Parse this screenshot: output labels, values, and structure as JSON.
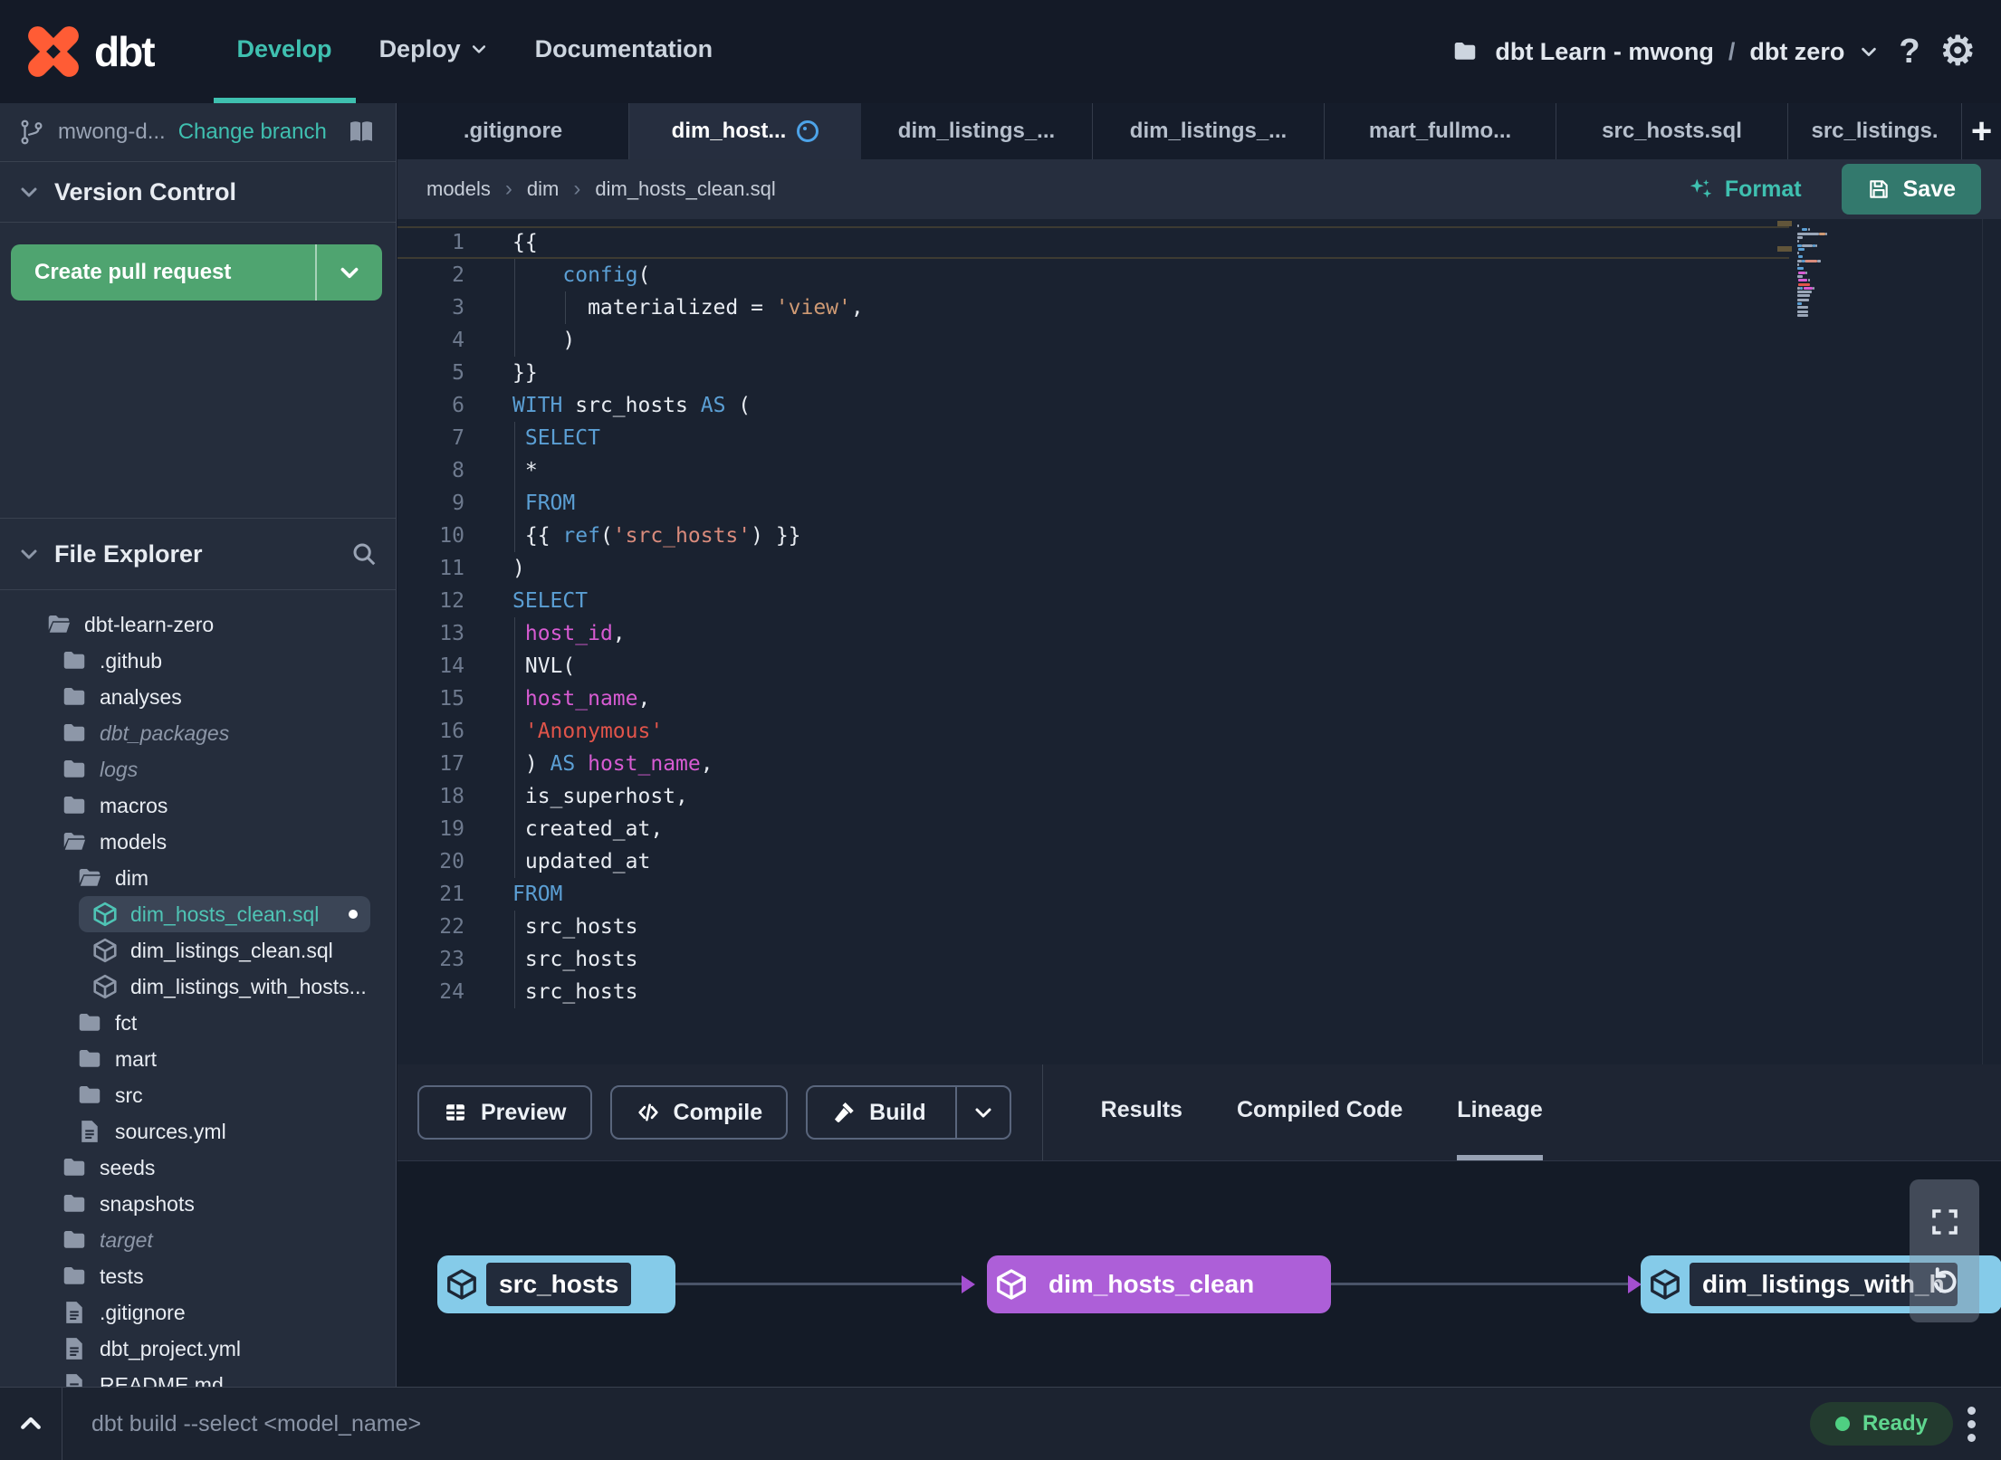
{
  "topnav": {
    "logo_text": "dbt",
    "items": [
      {
        "label": "Develop",
        "active": true,
        "chevron": false
      },
      {
        "label": "Deploy",
        "active": false,
        "chevron": true
      },
      {
        "label": "Documentation",
        "active": false,
        "chevron": false
      }
    ],
    "project_account": "dbt Learn - mwong",
    "project_separator": "/",
    "project_name": "dbt zero",
    "help_label": "?",
    "gear_glyph": "⚙"
  },
  "sidebar": {
    "branch_name": "mwong-d...",
    "change_branch_label": "Change branch",
    "version_control_title": "Version Control",
    "create_pr_label": "Create pull request",
    "file_explorer_title": "File Explorer",
    "tree": [
      {
        "label": "dbt-learn-zero",
        "icon": "folder-open",
        "indent": 0
      },
      {
        "label": ".github",
        "icon": "folder",
        "indent": 1
      },
      {
        "label": "analyses",
        "icon": "folder",
        "indent": 1
      },
      {
        "label": "dbt_packages",
        "icon": "folder",
        "indent": 1,
        "italic": true
      },
      {
        "label": "logs",
        "icon": "folder",
        "indent": 1,
        "italic": true
      },
      {
        "label": "macros",
        "icon": "folder",
        "indent": 1
      },
      {
        "label": "models",
        "icon": "folder-open",
        "indent": 1
      },
      {
        "label": "dim",
        "icon": "folder-open",
        "indent": 2
      },
      {
        "label": "dim_hosts_clean.sql",
        "icon": "model",
        "indent": 3,
        "selected": true,
        "modified": true
      },
      {
        "label": "dim_listings_clean.sql",
        "icon": "model",
        "indent": 3
      },
      {
        "label": "dim_listings_with_hosts...",
        "icon": "model",
        "indent": 3
      },
      {
        "label": "fct",
        "icon": "folder",
        "indent": 2
      },
      {
        "label": "mart",
        "icon": "folder",
        "indent": 2
      },
      {
        "label": "src",
        "icon": "folder",
        "indent": 2
      },
      {
        "label": "sources.yml",
        "icon": "file",
        "indent": 2
      },
      {
        "label": "seeds",
        "icon": "folder",
        "indent": 1
      },
      {
        "label": "snapshots",
        "icon": "folder",
        "indent": 1
      },
      {
        "label": "target",
        "icon": "folder",
        "indent": 1,
        "italic": true
      },
      {
        "label": "tests",
        "icon": "folder",
        "indent": 1
      },
      {
        "label": ".gitignore",
        "icon": "file",
        "indent": 1
      },
      {
        "label": "dbt_project.yml",
        "icon": "file",
        "indent": 1
      },
      {
        "label": "README.md",
        "icon": "file",
        "indent": 1
      }
    ]
  },
  "tabs": [
    {
      "label": ".gitignore"
    },
    {
      "label": "dim_host...",
      "active": true,
      "modified": true
    },
    {
      "label": "dim_listings_..."
    },
    {
      "label": "dim_listings_..."
    },
    {
      "label": "mart_fullmo..."
    },
    {
      "label": "src_hosts.sql"
    },
    {
      "label": "src_listings.",
      "last": true
    }
  ],
  "new_tab_label": "+",
  "breadcrumb": {
    "parts": [
      "models",
      "dim",
      "dim_hosts_clean.sql"
    ],
    "separator": "›"
  },
  "actions": {
    "format_label": "Format",
    "save_label": "Save"
  },
  "editor": {
    "lines": [
      {
        "n": 1,
        "cur": true,
        "t": [
          [
            "p",
            "{{"
          ]
        ]
      },
      {
        "n": 2,
        "g": [
          2
        ],
        "t": [
          [
            "p",
            "    "
          ],
          [
            "k",
            "config"
          ],
          [
            "p",
            "("
          ]
        ]
      },
      {
        "n": 3,
        "g": [
          2,
          58
        ],
        "t": [
          [
            "p",
            "      materialized = "
          ],
          [
            "s1",
            "'view'"
          ],
          [
            "p",
            ","
          ]
        ]
      },
      {
        "n": 4,
        "g": [
          2
        ],
        "t": [
          [
            "p",
            "    )"
          ]
        ]
      },
      {
        "n": 5,
        "t": [
          [
            "p",
            "}}"
          ]
        ]
      },
      {
        "n": 6,
        "t": [
          [
            "k",
            "WITH"
          ],
          [
            "p",
            " src_hosts "
          ],
          [
            "k",
            "AS"
          ],
          [
            "p",
            " ("
          ]
        ]
      },
      {
        "n": 7,
        "g": [
          2
        ],
        "t": [
          [
            "p",
            " "
          ],
          [
            "k",
            "SELECT"
          ]
        ]
      },
      {
        "n": 8,
        "g": [
          2
        ],
        "t": [
          [
            "p",
            " *"
          ]
        ]
      },
      {
        "n": 9,
        "g": [
          2
        ],
        "t": [
          [
            "p",
            " "
          ],
          [
            "k",
            "FROM"
          ]
        ]
      },
      {
        "n": 10,
        "g": [
          2
        ],
        "t": [
          [
            "p",
            " {{ "
          ],
          [
            "k",
            "ref"
          ],
          [
            "p",
            "("
          ],
          [
            "s2",
            "'src_hosts'"
          ],
          [
            "p",
            ") }}"
          ]
        ]
      },
      {
        "n": 11,
        "t": [
          [
            "p",
            ")"
          ]
        ]
      },
      {
        "n": 12,
        "t": [
          [
            "k",
            "SELECT"
          ]
        ]
      },
      {
        "n": 13,
        "g": [
          2
        ],
        "t": [
          [
            "p",
            " "
          ],
          [
            "m",
            "host_id"
          ],
          [
            "p",
            ","
          ]
        ]
      },
      {
        "n": 14,
        "g": [
          2
        ],
        "t": [
          [
            "p",
            " NVL("
          ]
        ]
      },
      {
        "n": 15,
        "g": [
          2
        ],
        "t": [
          [
            "p",
            " "
          ],
          [
            "m",
            "host_name"
          ],
          [
            "p",
            ","
          ]
        ]
      },
      {
        "n": 16,
        "g": [
          2
        ],
        "t": [
          [
            "p",
            " "
          ],
          [
            "s3",
            "'Anonymous'"
          ]
        ]
      },
      {
        "n": 17,
        "g": [
          2
        ],
        "t": [
          [
            "p",
            " ) "
          ],
          [
            "k",
            "AS"
          ],
          [
            "p",
            " "
          ],
          [
            "m",
            "host_name"
          ],
          [
            "p",
            ","
          ]
        ]
      },
      {
        "n": 18,
        "g": [
          2
        ],
        "t": [
          [
            "p",
            " is_superhost,"
          ]
        ]
      },
      {
        "n": 19,
        "g": [
          2
        ],
        "t": [
          [
            "p",
            " created_at,"
          ]
        ]
      },
      {
        "n": 20,
        "g": [
          2
        ],
        "t": [
          [
            "p",
            " updated_at"
          ]
        ]
      },
      {
        "n": 21,
        "t": [
          [
            "k",
            "FROM"
          ]
        ]
      },
      {
        "n": 22,
        "g": [
          2
        ],
        "t": [
          [
            "p",
            " src_hosts"
          ]
        ]
      },
      {
        "n": 23,
        "g": [
          2
        ],
        "t": [
          [
            "p",
            " src_hosts"
          ]
        ]
      },
      {
        "n": 24,
        "g": [
          2
        ],
        "t": [
          [
            "p",
            " src_hosts"
          ]
        ]
      }
    ]
  },
  "bottom_panel": {
    "buttons": [
      {
        "label": "Preview",
        "icon": "preview"
      },
      {
        "label": "Compile",
        "icon": "compile"
      },
      {
        "label": "Build",
        "icon": "build",
        "split": true
      }
    ],
    "tabs": [
      {
        "label": "Results"
      },
      {
        "label": "Compiled Code"
      },
      {
        "label": "Lineage",
        "active": true
      }
    ]
  },
  "lineage": {
    "nodes": [
      {
        "label": "src_hosts",
        "style": "blue"
      },
      {
        "label": "dim_hosts_clean",
        "style": "purple"
      },
      {
        "label": "dim_listings_with_h",
        "style": "blue"
      }
    ]
  },
  "statusbar": {
    "command_placeholder": "dbt build --select <model_name>",
    "status_label": "Ready"
  },
  "colors": {
    "accent_teal": "#3fc0b0",
    "logo_orange": "#ff5c35",
    "pr_green": "#4fa470",
    "save_teal": "#33796d",
    "node_blue": "#85cbe9",
    "node_purple": "#ad5fd8",
    "edge_arrow_purple": "#a44fd0",
    "status_green": "#5fd68f",
    "keyword_blue": "#5b9fd4",
    "string_orange": "#cf9a74",
    "string_salmon": "#d98b7c",
    "string_red": "#e0544a",
    "column_magenta": "#d75bd2"
  }
}
